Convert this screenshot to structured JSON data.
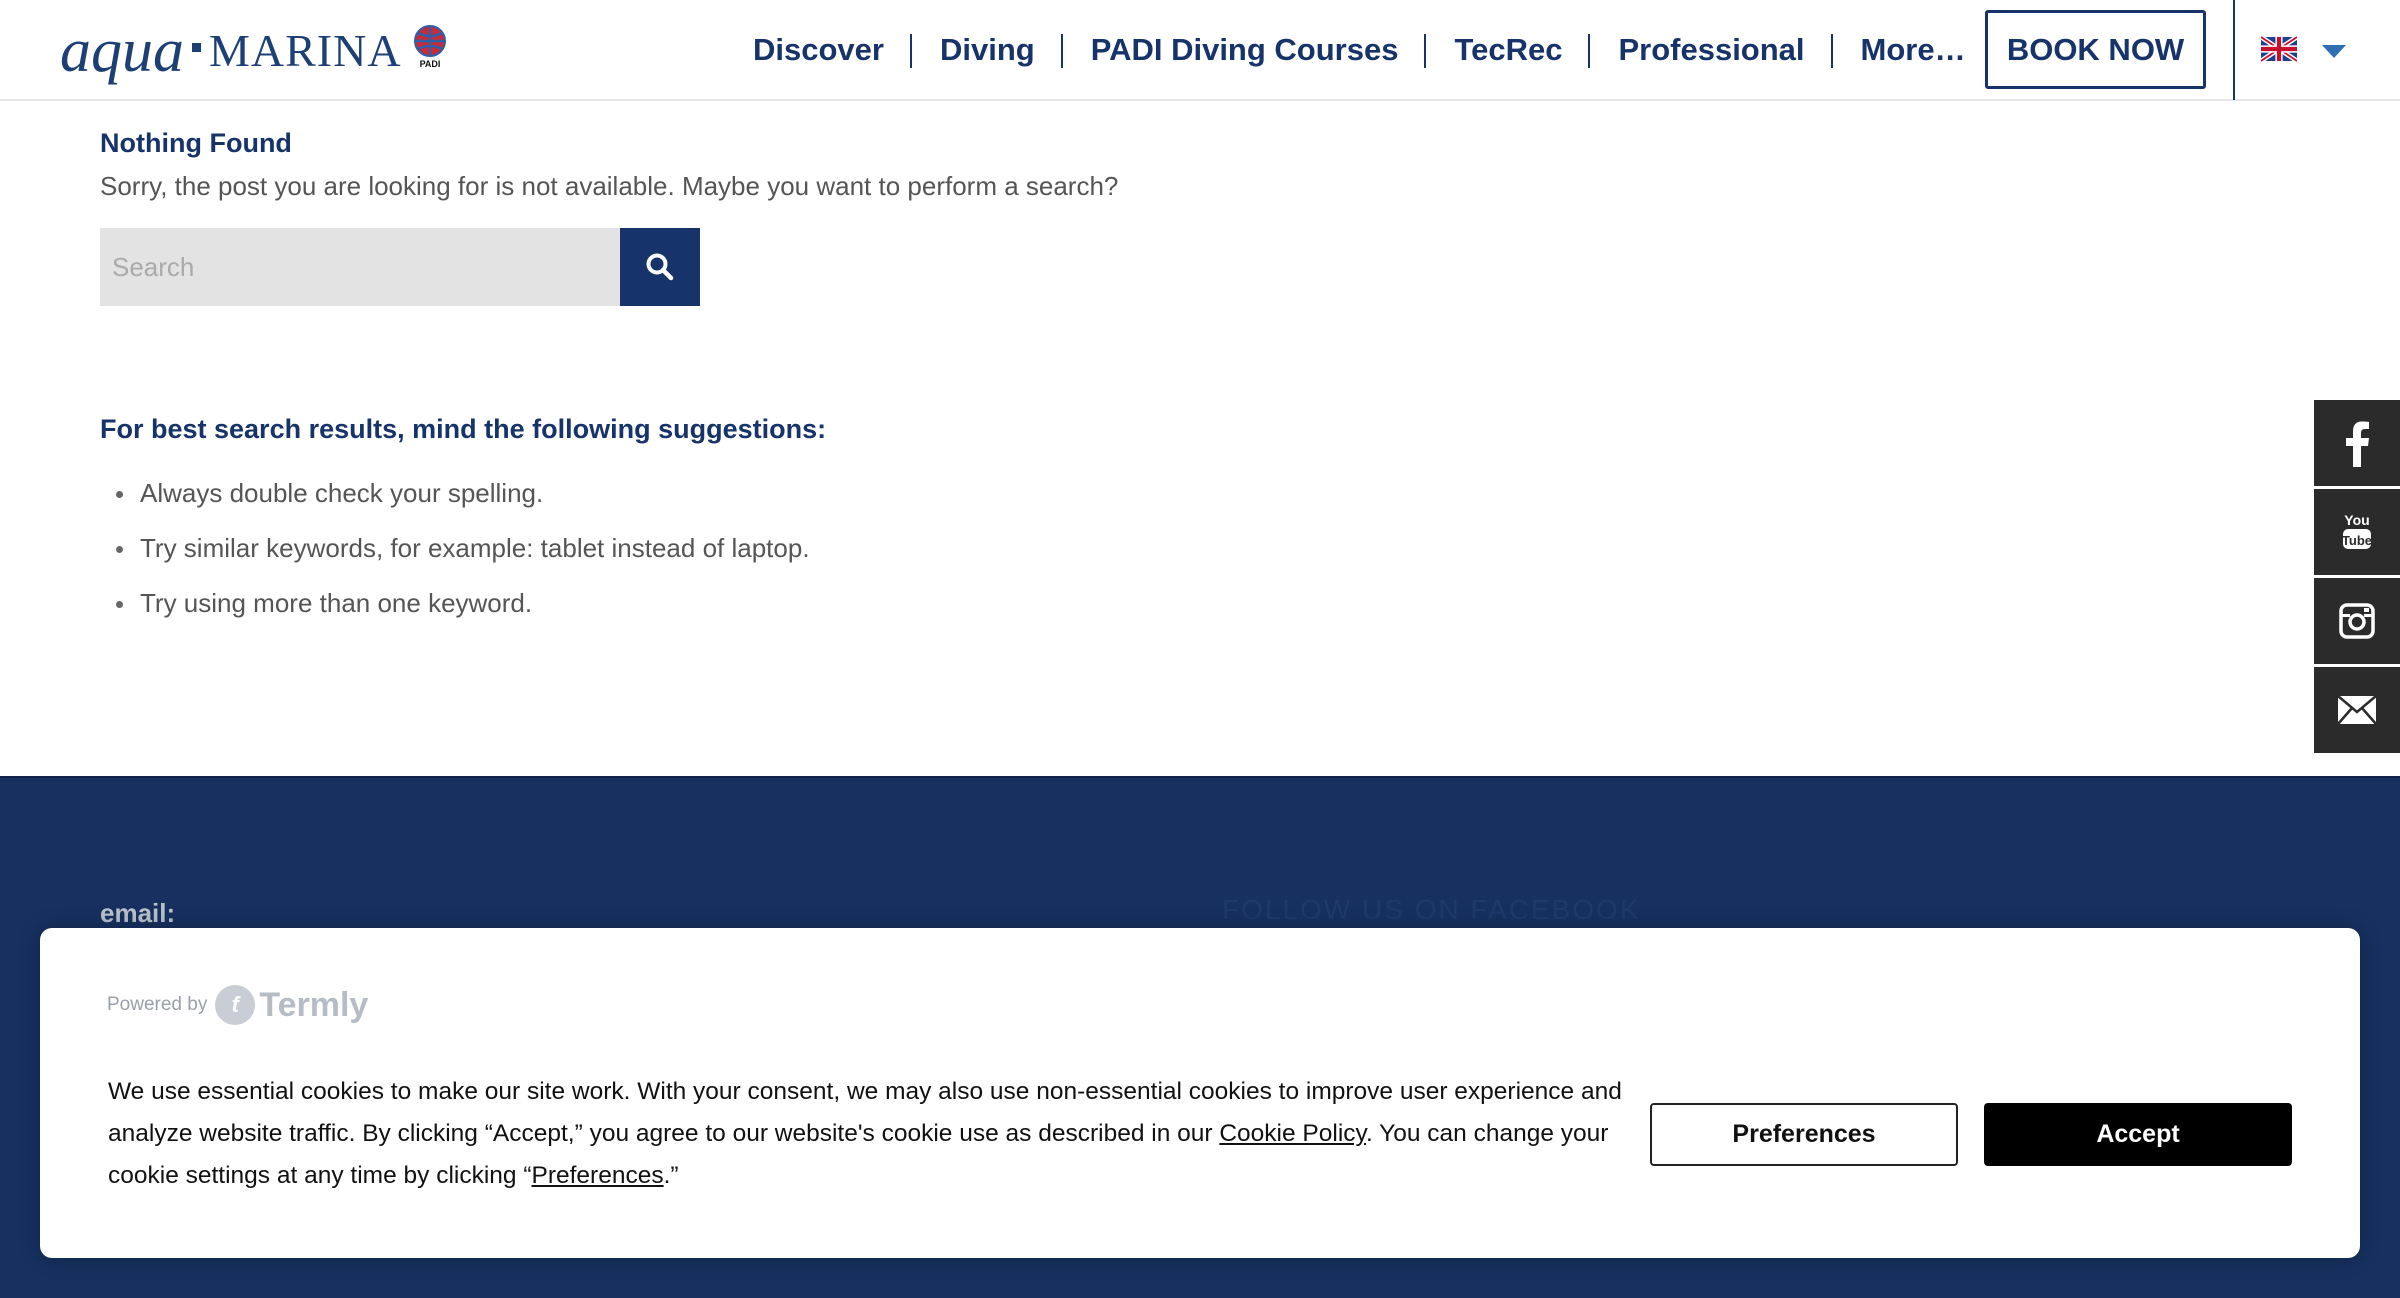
{
  "header": {
    "logo_text_1": "aqua",
    "logo_text_2": "MARINA",
    "logo_badge": "PADI",
    "nav": [
      {
        "label": "Discover"
      },
      {
        "label": "Diving"
      },
      {
        "label": "PADI Diving Courses"
      },
      {
        "label": "TecRec"
      },
      {
        "label": "Professional"
      },
      {
        "label": "More…"
      }
    ],
    "book_now": "BOOK NOW",
    "language_icon": "uk-flag-icon"
  },
  "main": {
    "title": "Nothing Found",
    "message": "Sorry, the post you are looking for is not available. Maybe you want to perform a search?",
    "search": {
      "placeholder": "Search",
      "value": ""
    },
    "suggestions_title": "For best search results, mind the following suggestions:",
    "suggestions": [
      "Always double check your spelling.",
      "Try similar keywords, for example: tablet instead of laptop.",
      "Try using more than one keyword."
    ]
  },
  "social": [
    "facebook-icon",
    "youtube-icon",
    "instagram-icon",
    "mail-icon"
  ],
  "footer": {
    "email_label": "email:",
    "follow_label": "FOLLOW US ON FACEBOOK"
  },
  "cookie_banner": {
    "powered_by": "Powered by",
    "brand": "Termly",
    "text_1": "We use essential cookies to make our site work. With your consent, we may also use non-essential cookies to improve user experience and analyze website traffic. By clicking “Accept,” you agree to our website's cookie use as described in our ",
    "cookie_policy_link": "Cookie Policy",
    "text_2": ". You can change your cookie settings at any time by clicking “",
    "preferences_link": "Preferences",
    "text_3": ".”",
    "preferences_button": "Preferences",
    "accept_button": "Accept"
  },
  "colors": {
    "brand_navy": "#16336a",
    "footer_bg": "#17305f",
    "social_bg": "#2b2b2b"
  }
}
